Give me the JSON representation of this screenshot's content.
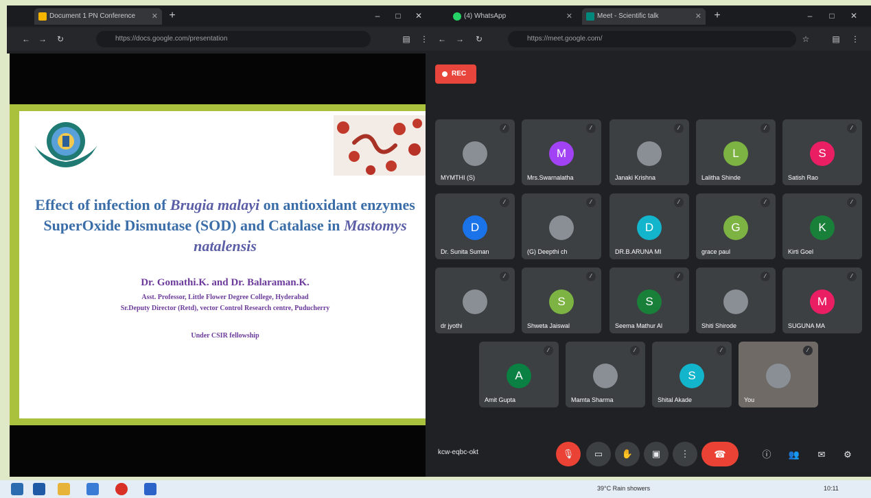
{
  "browser": {
    "tabs": [
      {
        "label": "Document 1 PN Conference"
      },
      {
        "label": "(4) WhatsApp"
      },
      {
        "label": "Meet - Scientific talk"
      }
    ],
    "left_address": "https://docs.google.com/presentation",
    "right_address": "https://meet.google.com/"
  },
  "slide": {
    "title_part1": "Effect of infection of ",
    "title_italic1": "Brugia malayi",
    "title_part2": " on antioxidant enzymes SuperOxide Dismutase (SOD) and Catalase in ",
    "title_italic2": "Mastomys natalensis",
    "authors": "Dr. Gomathi.K. and Dr. Balaraman.K.",
    "affiliation1": "Asst. Professor, Little Flower Degree College, Hyderabad",
    "affiliation2": "Sr.Deputy Director (Retd), vector Control Research centre, Puducherry",
    "fellowship": "Under CSIR fellowship"
  },
  "meet": {
    "rec_label": "REC",
    "meeting_code": "kcw-eqbc-okt",
    "participants": [
      {
        "name": "MYMTHI (S)",
        "initial": "",
        "color": "#3c4043"
      },
      {
        "name": "Mrs.Swarnalatha",
        "initial": "M",
        "color": "#a142f4"
      },
      {
        "name": "Janaki Krishna",
        "initial": "",
        "color": "#3c4043"
      },
      {
        "name": "Lalitha Shinde",
        "initial": "L",
        "color": "#7cb342"
      },
      {
        "name": "Satish Rao",
        "initial": "S",
        "color": "#e91e63"
      },
      {
        "name": "Dr. Sunita Suman",
        "initial": "D",
        "color": "#1a73e8"
      },
      {
        "name": "(G) Deepthi ch",
        "initial": "",
        "color": "#3c4043"
      },
      {
        "name": "DR.B.ARUNA MI",
        "initial": "D",
        "color": "#12b5cb"
      },
      {
        "name": "grace paul",
        "initial": "G",
        "color": "#7cb342"
      },
      {
        "name": "Kirti Goel",
        "initial": "K",
        "color": "#188038"
      },
      {
        "name": "dr jyothi",
        "initial": "",
        "color": "#3c4043"
      },
      {
        "name": "Shweta Jaiswal",
        "initial": "S",
        "color": "#7cb342"
      },
      {
        "name": "Seema Mathur Al",
        "initial": "S",
        "color": "#188038"
      },
      {
        "name": "Shiti Shirode",
        "initial": "",
        "color": "#3c4043"
      },
      {
        "name": "SUGUNA MA",
        "initial": "M",
        "color": "#e91e63"
      },
      {
        "name": "Amit Gupta",
        "initial": "A",
        "color": "#0b8043"
      },
      {
        "name": "Mamta Sharma",
        "initial": "",
        "color": "#3c4043"
      },
      {
        "name": "Shital Akade",
        "initial": "S",
        "color": "#12b5cb"
      },
      {
        "name": "You",
        "initial": "",
        "color": "#6f6a66"
      }
    ]
  },
  "taskbar": {
    "weather": "39°C Rain showers",
    "time": "10:11"
  }
}
